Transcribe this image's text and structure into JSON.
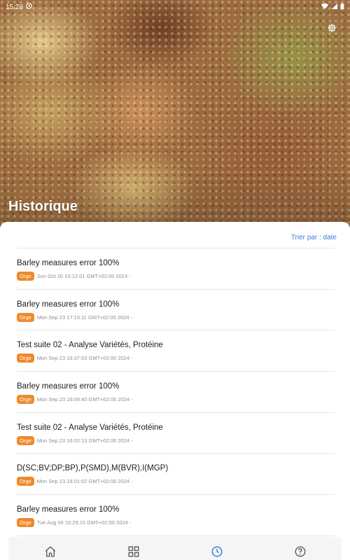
{
  "status_bar": {
    "time": "15:28"
  },
  "page": {
    "title": "Historique",
    "sort_label": "Trier par : date"
  },
  "history": [
    {
      "title": "Barley measures error 100%",
      "tag": "Orge",
      "date": "Sun Oct 20 15:12:01 GMT+02:00 2024 -"
    },
    {
      "title": "Barley measures error 100%",
      "tag": "Orge",
      "date": "Mon Sep 23 17:10:11 GMT+02:00 2024 -"
    },
    {
      "title": "Test suite 02 - Analyse Variétés, Protéine",
      "tag": "Orge",
      "date": "Mon Sep 23 16:37:03 GMT+02:00 2024 -"
    },
    {
      "title": "Barley measures error 100%",
      "tag": "Orge",
      "date": "Mon Sep 23 16:09:40 GMT+02:00 2024 -"
    },
    {
      "title": "Test suite 02 - Analyse Variétés, Protéine",
      "tag": "Orge",
      "date": "Mon Sep 23 16:02:13 GMT+02:00 2024 -"
    },
    {
      "title": "D(SC;BV;DP;BP),P(SMD),M(BVR),I(MGP)",
      "tag": "Orge",
      "date": "Mon Sep 23 16:01:02 GMT+02:00 2024 -"
    },
    {
      "title": "Barley measures error 100%",
      "tag": "Orge",
      "date": "Tue Aug 06 15:29:15 GMT+02:00 2024 -"
    }
  ],
  "nav": {
    "items": [
      {
        "icon": "home-icon",
        "active": false
      },
      {
        "icon": "grid-icon",
        "active": false
      },
      {
        "icon": "clock-icon",
        "active": true
      },
      {
        "icon": "help-icon",
        "active": false
      }
    ]
  },
  "colors": {
    "accent": "#3f7fd6",
    "badge": "#ee8a2c",
    "nav_inactive": "#555555"
  }
}
